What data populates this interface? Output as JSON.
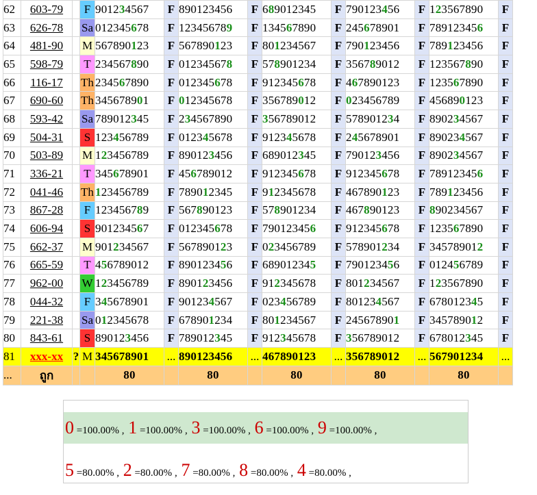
{
  "rows": [
    {
      "no": "62",
      "code": "603-79",
      "day": "F",
      "nums": [
        "901234567",
        "890123456",
        "689012345",
        "790123456",
        "123567890"
      ],
      "hl": [
        3,
        7,
        8,
        4,
        2
      ]
    },
    {
      "no": "63",
      "code": "626-78",
      "day": "Sa",
      "nums": [
        "012345678",
        "123456789",
        "134567890",
        "245678901",
        "789123456"
      ],
      "hl": [
        6,
        9,
        6,
        6,
        6
      ]
    },
    {
      "no": "64",
      "code": "481-90",
      "day": "M",
      "nums": [
        "567890123",
        "567890123",
        "801234567",
        "790123456",
        "789123456"
      ],
      "hl": [
        1,
        1,
        1,
        1,
        1
      ]
    },
    {
      "no": "65",
      "code": "598-79",
      "day": "T",
      "nums": [
        "234567890",
        "012345678",
        "578901234",
        "356789012",
        "123567890"
      ],
      "hl": [
        8,
        8,
        8,
        8,
        8
      ]
    },
    {
      "no": "66",
      "code": "116-17",
      "day": "Th",
      "nums": [
        "234567890",
        "012345678",
        "912345678",
        "467890123",
        "123567890"
      ],
      "hl": [
        6,
        6,
        6,
        6,
        6
      ]
    },
    {
      "no": "67",
      "code": "690-60",
      "day": "Th",
      "nums": [
        "345678901",
        "012345678",
        "356789012",
        "023456789",
        "456890123"
      ],
      "hl": [
        0,
        0,
        0,
        0,
        0
      ]
    },
    {
      "no": "68",
      "code": "593-42",
      "day": "Sa",
      "nums": [
        "789012345",
        "234567890",
        "356789012",
        "578901234",
        "890234567"
      ],
      "hl": [
        3,
        3,
        3,
        3,
        3
      ]
    },
    {
      "no": "69",
      "code": "504-31",
      "day": "S",
      "nums": [
        "123456789",
        "012345678",
        "912345678",
        "245678901",
        "890234567"
      ],
      "hl": [
        4,
        4,
        4,
        4,
        4
      ]
    },
    {
      "no": "70",
      "code": "503-89",
      "day": "M",
      "nums": [
        "123456789",
        "890123456",
        "689012345",
        "790123456",
        "890234567"
      ],
      "hl": [
        2,
        3,
        3,
        3,
        3
      ]
    },
    {
      "no": "71",
      "code": "336-21",
      "day": "T",
      "nums": [
        "345678901",
        "456789012",
        "912345678",
        "912345678",
        "789123456"
      ],
      "hl": [
        6,
        6,
        6,
        6,
        6
      ]
    },
    {
      "no": "72",
      "code": "041-46",
      "day": "Th",
      "nums": [
        "123456789",
        "789012345",
        "912345678",
        "467890123",
        "789123456"
      ],
      "hl": [
        1,
        1,
        1,
        1,
        1
      ]
    },
    {
      "no": "73",
      "code": "867-28",
      "day": "F",
      "nums": [
        "123456789",
        "567890123",
        "578901234",
        "467890123",
        "890234567"
      ],
      "hl": [
        8,
        8,
        8,
        8,
        8
      ]
    },
    {
      "no": "74",
      "code": "606-94",
      "day": "S",
      "nums": [
        "901234567",
        "012345678",
        "790123456",
        "912345678",
        "123567890"
      ],
      "hl": [
        6,
        6,
        6,
        6,
        6
      ]
    },
    {
      "no": "75",
      "code": "662-37",
      "day": "M",
      "nums": [
        "901234567",
        "567890123",
        "023456789",
        "578901234",
        "345789012"
      ],
      "hl": [
        2,
        2,
        2,
        2,
        2
      ]
    },
    {
      "no": "76",
      "code": "665-59",
      "day": "T",
      "nums": [
        "456789012",
        "890123456",
        "689012345",
        "790123456",
        "012456789"
      ],
      "hl": [
        5,
        5,
        5,
        5,
        5
      ]
    },
    {
      "no": "77",
      "code": "962-00",
      "day": "W",
      "nums": [
        "123456789",
        "890123456",
        "912345678",
        "801234567",
        "123567890"
      ],
      "hl": [
        2,
        2,
        2,
        2,
        2
      ]
    },
    {
      "no": "78",
      "code": "044-32",
      "day": "F",
      "nums": [
        "345678901",
        "901234567",
        "023456789",
        "801234567",
        "678012345"
      ],
      "hl": [
        4,
        4,
        4,
        4,
        4
      ]
    },
    {
      "no": "79",
      "code": "221-38",
      "day": "Sa",
      "nums": [
        "012345678",
        "678901234",
        "801234567",
        "245678901",
        "345789012"
      ],
      "hl": [
        1,
        1,
        1,
        1,
        1
      ]
    },
    {
      "no": "80",
      "code": "843-61",
      "day": "S",
      "nums": [
        "890123456",
        "789012345",
        "912345678",
        "356789012",
        "678012345"
      ],
      "hl": [
        3,
        3,
        3,
        3,
        3
      ]
    }
  ],
  "row81": {
    "no": "81",
    "code": "xxx-xx",
    "q": "?",
    "day": "M",
    "nums": [
      "345678901",
      "890123456",
      "467890123",
      "356789012",
      "567901234"
    ],
    "dot": "..."
  },
  "footer": {
    "no": "...",
    "label": "ถูก",
    "counts": [
      "80",
      "80",
      "80",
      "80",
      "80"
    ]
  },
  "result_label": "F",
  "summary": {
    "line1": [
      {
        "digit": "0",
        "pct": "=100.00%"
      },
      {
        "digit": "1",
        "pct": "=100.00%"
      },
      {
        "digit": "3",
        "pct": "=100.00%"
      },
      {
        "digit": "6",
        "pct": "=100.00%"
      },
      {
        "digit": "9",
        "pct": "=100.00%"
      }
    ],
    "line2": [
      {
        "digit": "5",
        "pct": "=80.00%"
      },
      {
        "digit": "2",
        "pct": "=80.00%"
      },
      {
        "digit": "7",
        "pct": "=80.00%"
      },
      {
        "digit": "8",
        "pct": "=80.00%"
      },
      {
        "digit": "4",
        "pct": "=80.00%"
      }
    ]
  },
  "colors": {
    "green": "#1a8f1a",
    "red": "#cc0000",
    "yellow": "#ffff00",
    "orange": "#ffcc80",
    "result_bg": "#dde4f7"
  }
}
